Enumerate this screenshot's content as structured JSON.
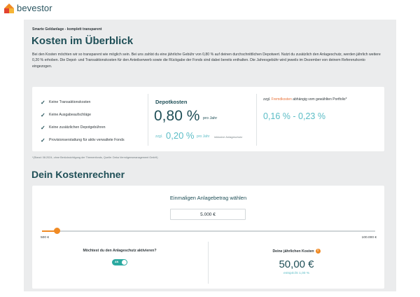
{
  "brand": {
    "name": "bevestor",
    "colors": {
      "primary": "#1f4f57",
      "accent": "#f08a24",
      "teal": "#5bbdc6"
    }
  },
  "overview": {
    "kicker": "Smarte Geldanlage - komplett transparent",
    "title": "Kosten im Überblick",
    "intro": "Bei den Kosten möchten wir so transparent wie möglich sein. Bei uns zahlst du eine jährliche Gebühr von 0,80 % auf deinen durchschnittlichen Depotwert. Nutzt du zusätzlich den Anlageschutz, werden jährlich weitere 0,20 % erhoben. Die Depot- und Transaktionskosten für den Anteilserwerb sowie die Rückgabe der Fonds sind dabei bereits enthalten. Die Jahresgebühr wird jeweils im Dezember von deinem Referenzkonto eingezogen.",
    "checks": [
      "Keine Transaktionskosten",
      "Keine Ausgabeaufschläge",
      "Keine zusätzlichen Depotgebühren",
      "Provisionserstattung für aktiv verwaltete Fonds"
    ],
    "depot": {
      "title": "Depotkosten",
      "value": "0,80 %",
      "unit": "pro Jahr",
      "extra_label": "zzgl.",
      "extra_value": "0,20 %",
      "extra_unit": "pro Jahr",
      "extra_note": "inklusive Anlageschutz"
    },
    "fremd": {
      "prefix": "zzgl.",
      "highlight": "Fremdkosten",
      "suffix": "abhängig vom gewählten Portfolio*",
      "value": "0,16 % - 0,23 %"
    },
    "footnote": "*(Stand: 08.2024, ohne Berücksichtigung der Themenfonds, Quelle: Deka Vermögensmanagement GmbH)"
  },
  "calculator": {
    "title": "Dein Kostenrechner",
    "subtitle": "Einmaligen Anlagebetrag wählen",
    "amount": "5.000 €",
    "slider_min": "500 €",
    "slider_max": "100.000 €",
    "slider_fraction": 0.045,
    "protection_question": "Möchtest du den Anlageschutz aktivieren?",
    "toggle_label": "AN",
    "toggle_on": true,
    "costs_label": "Deine jährlichen Kosten",
    "info_icon": "i",
    "costs_value": "50,00 €",
    "costs_sub_prefix": "entspricht",
    "costs_sub_value": "1,00 %"
  }
}
